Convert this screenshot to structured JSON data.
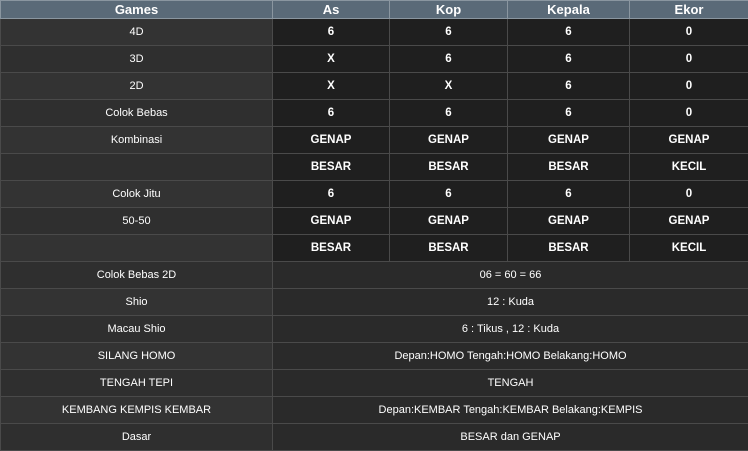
{
  "headers": [
    "Games",
    "As",
    "Kop",
    "Kepala",
    "Ekor"
  ],
  "rows": [
    {
      "label": "4D",
      "values": [
        "6",
        "6",
        "6",
        "0"
      ]
    },
    {
      "label": "3D",
      "values": [
        "X",
        "6",
        "6",
        "0"
      ]
    },
    {
      "label": "2D",
      "values": [
        "X",
        "X",
        "6",
        "0"
      ]
    },
    {
      "label": "Colok Bebas",
      "values": [
        "6",
        "6",
        "6",
        "0"
      ]
    },
    {
      "label": "Kombinasi",
      "values": [
        "GENAP",
        "GENAP",
        "GENAP",
        "GENAP"
      ]
    },
    {
      "label": "",
      "values": [
        "BESAR",
        "BESAR",
        "BESAR",
        "KECIL"
      ]
    },
    {
      "label": "Colok Jitu",
      "values": [
        "6",
        "6",
        "6",
        "0"
      ]
    },
    {
      "label": "50-50",
      "values": [
        "GENAP",
        "GENAP",
        "GENAP",
        "GENAP"
      ]
    },
    {
      "label": "",
      "values": [
        "BESAR",
        "BESAR",
        "BESAR",
        "KECIL"
      ]
    }
  ],
  "merged_rows": [
    {
      "label": "Colok Bebas 2D",
      "value": "06 = 60 = 66"
    },
    {
      "label": "Shio",
      "value": "12 : Kuda"
    },
    {
      "label": "Macau Shio",
      "value": "6 : Tikus , 12 : Kuda"
    },
    {
      "label": "SILANG HOMO",
      "value": "Depan:HOMO Tengah:HOMO Belakang:HOMO"
    },
    {
      "label": "TENGAH TEPI",
      "value": "TENGAH"
    },
    {
      "label": "KEMBANG KEMPIS KEMBAR",
      "value": "Depan:KEMBAR Tengah:KEMBAR Belakang:KEMPIS"
    },
    {
      "label": "Dasar",
      "value": "BESAR dan GENAP"
    }
  ]
}
